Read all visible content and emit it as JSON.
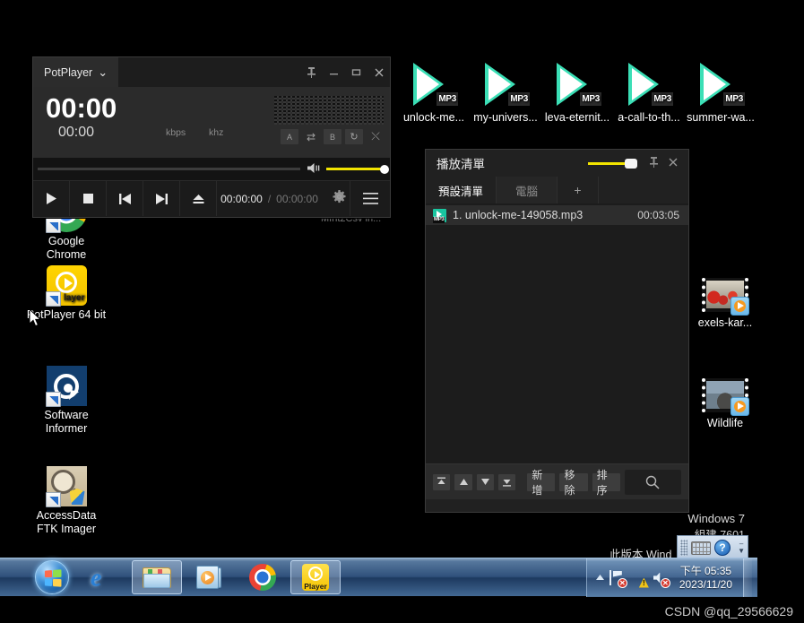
{
  "desktop": {
    "icons": [
      {
        "name": "Google Chrome",
        "label": "Google\nChrome",
        "type": "chrome",
        "partial": true
      },
      {
        "name": "PotPlayer 64 bit",
        "label": "PotPlayer 64 bit",
        "type": "potplayer"
      },
      {
        "name": "Software Informer",
        "label": "Software Informer",
        "type": "software-informer"
      },
      {
        "name": "AccessData FTK Imager",
        "label": "AccessData FTK Imager",
        "type": "ftk-imager"
      }
    ],
    "hidden_label": "MInt2Csv in...",
    "mp3_files": [
      {
        "label": "unlock-me...",
        "badge": "MP3"
      },
      {
        "label": "my-univers...",
        "badge": "MP3"
      },
      {
        "label": "leva-eternit...",
        "badge": "MP3"
      },
      {
        "label": "a-call-to-th...",
        "badge": "MP3"
      },
      {
        "label": "summer-wa...",
        "badge": "MP3"
      }
    ],
    "video_files": [
      {
        "label": "exels-kar..."
      },
      {
        "label": "Wildlife"
      }
    ]
  },
  "watermark": {
    "line1": "Windows 7",
    "line2": "組建 7601",
    "line3": "此版本 Wind"
  },
  "potplayer": {
    "title": "PotPlayer",
    "chevron": "⌄",
    "titlebar_buttons": [
      {
        "name": "pin",
        "glyph": "📌"
      },
      {
        "name": "minimize",
        "glyph": "–"
      },
      {
        "name": "maximize",
        "glyph": "□"
      },
      {
        "name": "close",
        "glyph": "✕"
      }
    ],
    "display": {
      "time_big": "00:00",
      "time_small": "00:00",
      "kbps": "kbps",
      "khz": "khz",
      "mini_buttons": [
        "A",
        "⇄",
        "B",
        "↻",
        "⤬"
      ]
    },
    "controls": {
      "play": "▶",
      "stop": "■",
      "prev": "⏮",
      "next": "⏭",
      "eject": "⏏",
      "time_current": "00:00:00",
      "time_separator": "/",
      "time_total": "00:00:00",
      "settings": "⚙",
      "menu": "☰"
    }
  },
  "playlist": {
    "title": "播放清單",
    "titlebar_buttons": [
      {
        "name": "pin",
        "glyph": "📌"
      },
      {
        "name": "close",
        "glyph": "✕"
      }
    ],
    "tabs": [
      {
        "label": "預設清單",
        "active": true
      },
      {
        "label": "電腦",
        "active": false
      },
      {
        "label": "+",
        "active": false
      }
    ],
    "items": [
      {
        "index": "1.",
        "name": "unlock-me-149058.mp3",
        "duration": "00:03:05",
        "type": "MP3"
      }
    ],
    "bottom_buttons": [
      {
        "name": "move-to-top",
        "glyph": "↥"
      },
      {
        "name": "move-up",
        "glyph": "▲"
      },
      {
        "name": "move-down",
        "glyph": "▼"
      },
      {
        "name": "move-to-bottom",
        "glyph": "↧"
      }
    ],
    "text_buttons": [
      {
        "name": "add",
        "label": "新增"
      },
      {
        "name": "remove",
        "label": "移除"
      },
      {
        "name": "sort",
        "label": "排序"
      }
    ],
    "search_icon": "🔍"
  },
  "taskbar": {
    "start_label": "Start",
    "items": [
      {
        "name": "internet-explorer",
        "glyph": "e",
        "open": false
      },
      {
        "name": "windows-explorer",
        "glyph": "",
        "open": true
      },
      {
        "name": "windows-media-player",
        "glyph": "",
        "open": false
      },
      {
        "name": "google-chrome",
        "glyph": "",
        "open": false
      },
      {
        "name": "potplayer",
        "glyph": "Player",
        "open": true
      }
    ],
    "tray": {
      "show_hidden": "▲",
      "icons": [
        "action-center-flag",
        "network-warning",
        "volume-muted"
      ],
      "time": "下午 05:35",
      "date": "2023/11/20"
    }
  },
  "eoa_toolbar": {
    "keyboard": "on-screen-keyboard",
    "help": "?",
    "minimize": "–",
    "expand": "▼"
  },
  "footer": {
    "csdn": "CSDN @qq_29566629"
  },
  "colors": {
    "accent_yellow": "#f2e400",
    "mp3_teal": "#3bdfb6",
    "taskbar_blue": "#2e5580",
    "potplayer_bg": "#1b1b1b",
    "playlist_bg": "#212121"
  }
}
